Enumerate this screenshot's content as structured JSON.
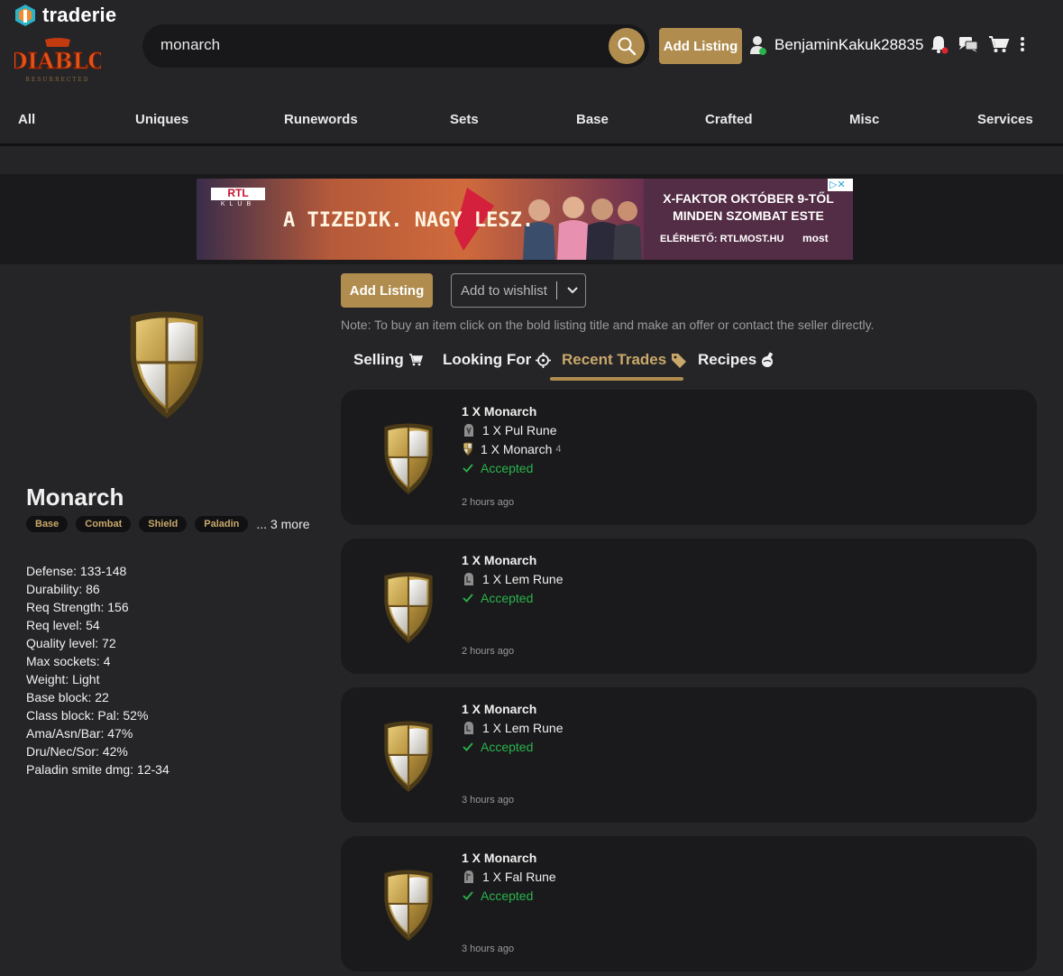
{
  "brand": {
    "name": "traderie",
    "game_logo_alt": "Diablo II Resurrected logo"
  },
  "search": {
    "value": "monarch"
  },
  "header": {
    "add_listing": "Add Listing",
    "username": "BenjaminKakuk28835"
  },
  "nav": {
    "items": [
      "All",
      "Uniques",
      "Runewords",
      "Sets",
      "Base",
      "Crafted",
      "Misc",
      "Services"
    ]
  },
  "ad": {
    "left_brand": "RTL",
    "left_sub": "KLUB",
    "slogan": "A TIZEDIK. NAGY LESZ.",
    "right_line1": "X-FAKTOR OKTÓBER 9-TŐL",
    "right_line2": "MINDEN SZOMBAT ESTE",
    "right_line3": "ELÉRHETŐ: RTLMOST.HU",
    "right_logo": "most"
  },
  "item": {
    "name": "Monarch",
    "tags": [
      "Base",
      "Combat",
      "Shield",
      "Paladin"
    ],
    "more": "... 3 more",
    "stats": [
      "Defense: 133-148",
      "Durability: 86",
      "Req Strength: 156",
      "Req level: 54",
      "Quality level: 72",
      "Max sockets: 4",
      "Weight: Light",
      "Base block: 22",
      "Class block: Pal: 52%",
      "Ama/Asn/Bar: 47%",
      "Dru/Nec/Sor: 42%",
      "Paladin smite dmg: 12-34"
    ]
  },
  "actions": {
    "add_listing": "Add Listing",
    "wishlist": "Add to wishlist"
  },
  "note": "Note: To buy an item click on the bold listing title and make an offer or contact the seller directly.",
  "tabs": [
    {
      "label": "Selling",
      "icon": "cart-icon"
    },
    {
      "label": "Looking For",
      "icon": "crosshair-icon"
    },
    {
      "label": "Recent Trades",
      "icon": "tag-icon",
      "active": true
    },
    {
      "label": "Recipes",
      "icon": "flask-icon"
    }
  ],
  "trades": [
    {
      "title": "1 X Monarch",
      "offers": [
        {
          "text": "1 X Pul Rune",
          "icon": "rune-icon"
        },
        {
          "text": "1 X Monarch",
          "icon": "shield-icon",
          "sockets": "4"
        }
      ],
      "status": "Accepted",
      "time": "2 hours ago"
    },
    {
      "title": "1 X Monarch",
      "offers": [
        {
          "text": "1 X Lem Rune",
          "icon": "rune-icon"
        }
      ],
      "status": "Accepted",
      "time": "2 hours ago"
    },
    {
      "title": "1 X Monarch",
      "offers": [
        {
          "text": "1 X Lem Rune",
          "icon": "rune-icon"
        }
      ],
      "status": "Accepted",
      "time": "3 hours ago"
    },
    {
      "title": "1 X Monarch",
      "offers": [
        {
          "text": "1 X Fal Rune",
          "icon": "rune-icon"
        }
      ],
      "status": "Accepted",
      "time": "3 hours ago"
    }
  ],
  "colors": {
    "accent": "#b08d4e",
    "accent_text": "#c9a86a",
    "background": "#252528",
    "card": "#1a1a1c",
    "accepted": "#2bb34b",
    "notify": "#e0262c"
  }
}
